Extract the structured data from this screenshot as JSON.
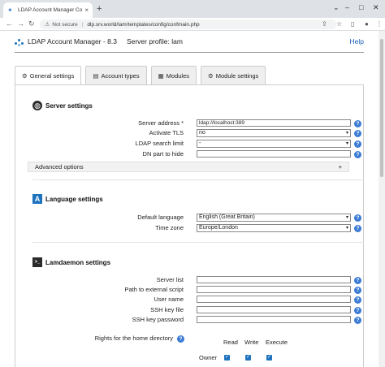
{
  "browser": {
    "tab_title": "LDAP Account Manager Configu",
    "new_tab": "+",
    "not_secure": "Not secure",
    "url": "dlp.srv.world/lam/templates/config/confmain.php"
  },
  "header": {
    "app_name": "LDAP Account Manager - 8.3",
    "profile": "Server profile: lam",
    "help": "Help"
  },
  "tabs": [
    {
      "label": "General settings",
      "icon": "gear-icon"
    },
    {
      "label": "Account types",
      "icon": "card-icon"
    },
    {
      "label": "Modules",
      "icon": "modules-icon"
    },
    {
      "label": "Module settings",
      "icon": "gear-icon"
    }
  ],
  "server": {
    "title": "Server settings",
    "address_label": "Server address *",
    "address_value": "ldap://localhost:389",
    "tls_label": "Activate TLS",
    "tls_value": "no",
    "limit_label": "LDAP search limit",
    "limit_value": "-",
    "dn_label": "DN part to hide",
    "dn_value": "",
    "advanced": "Advanced options",
    "advanced_toggle": "+"
  },
  "language": {
    "title": "Language settings",
    "default_label": "Default language",
    "default_value": "English (Great Britain)",
    "tz_label": "Time zone",
    "tz_value": "Europe/London"
  },
  "lamdaemon": {
    "title": "Lamdaemon settings",
    "server_list": "Server list",
    "script_path": "Path to external script",
    "user_name": "User name",
    "ssh_key": "SSH key file",
    "ssh_pw": "SSH key password",
    "rights_label": "Rights for the home directory",
    "col_read": "Read",
    "col_write": "Write",
    "col_execute": "Execute",
    "row_owner": "Owner"
  },
  "help_glyph": "?",
  "check_glyph": "✓",
  "colors": {
    "accent": "#1e73be",
    "help": "#3b7bd4"
  }
}
